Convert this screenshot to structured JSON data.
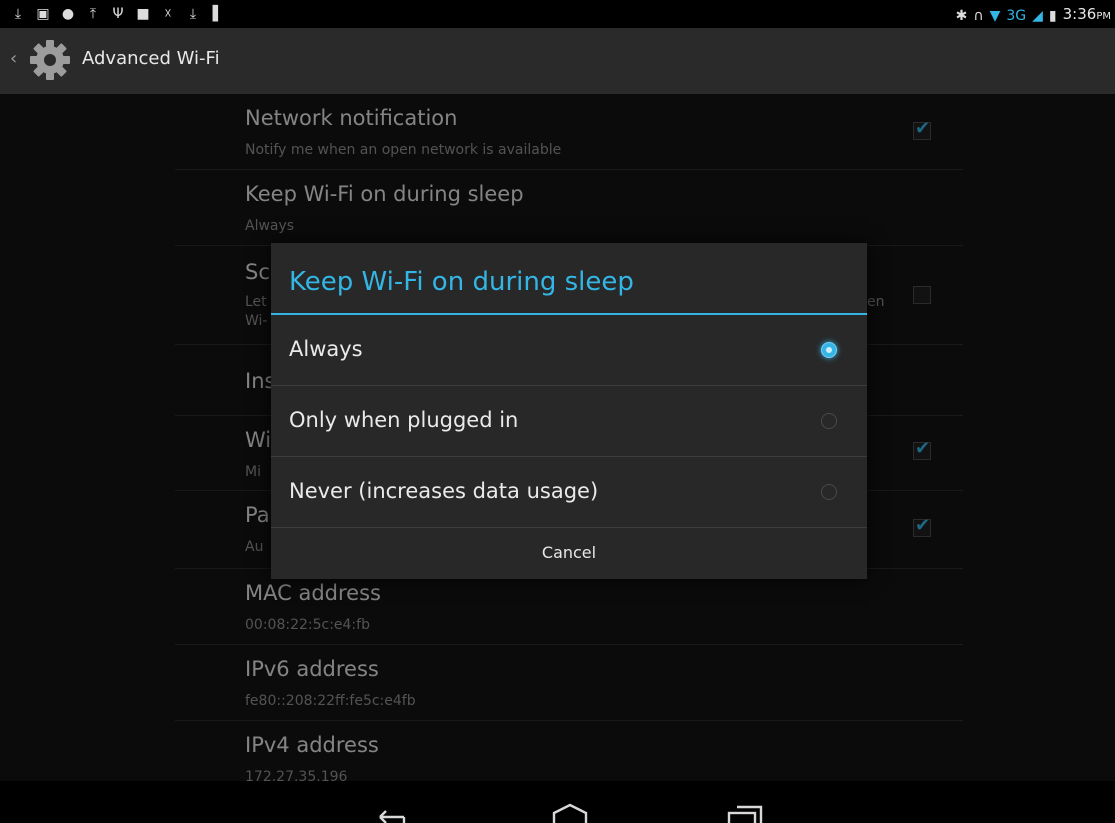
{
  "status_bar": {
    "left_icons": [
      "download-icon",
      "image-icon",
      "alert-icon",
      "upload-icon",
      "usb-icon",
      "lock-icon",
      "missed-call-icon",
      "download-icon",
      "barcode-icon"
    ],
    "right_icons": [
      "bluetooth-icon",
      "headset-icon",
      "wifi-icon",
      "signal-icon",
      "battery-icon"
    ],
    "network_type": "3G",
    "time": "3:36",
    "ampm": "PM"
  },
  "action_bar": {
    "title": "Advanced Wi-Fi"
  },
  "settings": [
    {
      "title": "Network notification",
      "summary": "Notify me when an open network is available",
      "checkbox": true,
      "checked": true
    },
    {
      "title": "Keep Wi-Fi on during sleep",
      "summary": "Always"
    },
    {
      "title": "Sc",
      "summary": "Let",
      "summary2": "Wi-",
      "tail": "en",
      "checkbox": true,
      "checked": false
    },
    {
      "title": "Ins"
    },
    {
      "title": "Wi",
      "summary": "Mi",
      "checkbox": true,
      "checked": true
    },
    {
      "title": "Pa",
      "summary": "Au",
      "checkbox": true,
      "checked": true
    },
    {
      "title": "MAC address",
      "summary": "00:08:22:5c:e4:fb"
    },
    {
      "title": "IPv6 address",
      "summary": "fe80::208:22ff:fe5c:e4fb"
    },
    {
      "title": "IPv4 address",
      "summary": "172.27.35.196"
    }
  ],
  "dialog": {
    "title": "Keep Wi-Fi on during sleep",
    "options": [
      {
        "label": "Always",
        "selected": true
      },
      {
        "label": "Only when plugged in",
        "selected": false
      },
      {
        "label": "Never (increases data usage)",
        "selected": false
      }
    ],
    "cancel_label": "Cancel"
  },
  "nav_bar": {
    "buttons": [
      "back-icon",
      "home-icon",
      "recents-icon"
    ]
  },
  "colors": {
    "accent": "#33b5e5",
    "background": "#131313",
    "dialog": "#282828"
  }
}
